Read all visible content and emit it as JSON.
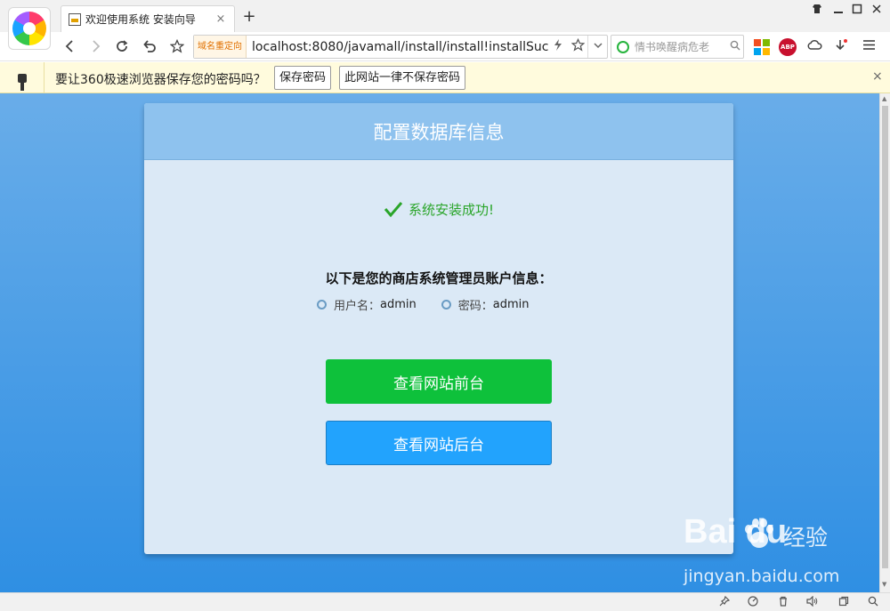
{
  "browser": {
    "tab_title": "欢迎使用系统 安装向导",
    "tab_close": "×",
    "new_tab": "+",
    "url_tag": "域名重定向",
    "url": "localhost:8080/javamall/install/install!installSuc",
    "search_placeholder": "情书唤醒病危老",
    "abp_label": "ABP"
  },
  "password_bar": {
    "message": "要让360极速浏览器保存您的密码吗？",
    "save_button": "保存密码",
    "never_button": "此网站一律不保存密码",
    "close": "×"
  },
  "card": {
    "title": "配置数据库信息",
    "success_message": "系统安装成功!",
    "info_title": "以下是您的商店系统管理员账户信息：",
    "username_label": "用户名：",
    "username_value": "admin",
    "password_label": "密码：",
    "password_value": "admin",
    "front_button": "查看网站前台",
    "back_button": "查看网站后台"
  },
  "watermark": {
    "logo_text": "Bai du",
    "sub_text": "经验",
    "url_text": "jingyan.baidu.com"
  },
  "colors": {
    "page_top": "#69ade9",
    "page_bottom": "#2f8fe3",
    "front_button": "#0ec13b",
    "back_button": "#22a3fd",
    "success": "#2aa52a"
  }
}
